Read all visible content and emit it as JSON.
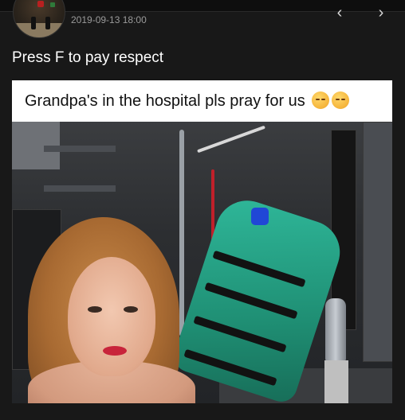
{
  "post": {
    "timestamp": "2019-09-13 18:00",
    "caption": "Press F to pay respect"
  },
  "navigation": {
    "prev_icon": "chevron-left-icon",
    "prev_glyph": "‹",
    "next_icon": "chevron-right-icon",
    "next_glyph": "›"
  },
  "meme": {
    "header_text": "Grandpa's in the hospital pls pray for us",
    "emojis": [
      "pensive-face-emoji",
      "pensive-face-emoji"
    ]
  },
  "colors": {
    "background": "#181818",
    "caption_text": "#ffffff",
    "timestamp_text": "#9a9a9a"
  }
}
